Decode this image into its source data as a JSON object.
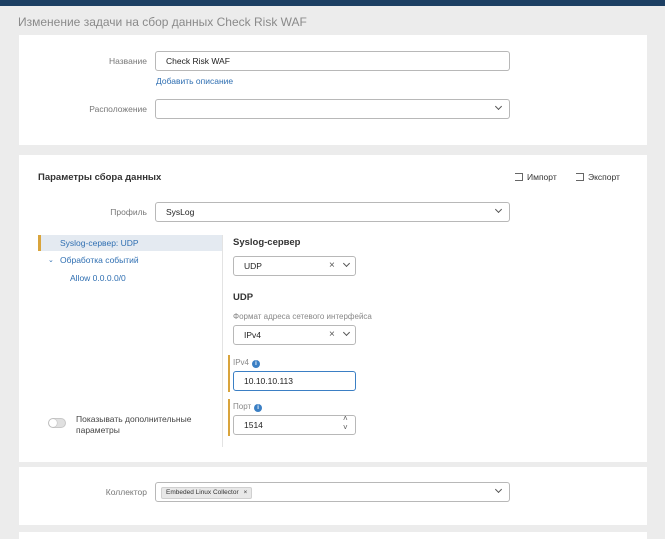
{
  "page": {
    "title": "Изменение задачи на сбор данных Check Risk WAF"
  },
  "general": {
    "name_label": "Название",
    "name_value": "Check Risk WAF",
    "add_description_link": "Добавить описание",
    "location_label": "Расположение",
    "location_value": ""
  },
  "params": {
    "title": "Параметры сбора данных",
    "import_label": "Импорт",
    "export_label": "Экспорт",
    "profile_label": "Профиль",
    "profile_value": "SysLog",
    "tree": {
      "selected": "Syslog-сервер: UDP",
      "group": "Обработка событий",
      "child": "Allow 0.0.0.0/0"
    },
    "toggle_label": "Показывать дополнительные параметры",
    "syslog_server_title": "Syslog-сервер",
    "protocol_value": "UDP",
    "udp_title": "UDP",
    "format_label": "Формат адреса сетевого интерфейса",
    "format_value": "IPv4",
    "ipv4_label": "IPv4",
    "ipv4_value": "10.10.10.113",
    "port_label": "Порт",
    "port_value": "1514"
  },
  "collector": {
    "label": "Коллектор",
    "chip": "Embeded Linux Collector"
  }
}
